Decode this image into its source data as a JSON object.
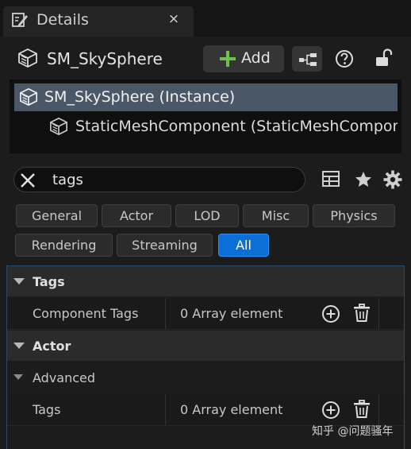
{
  "tab": {
    "title": "Details",
    "close": "×"
  },
  "header": {
    "actor_name": "SM_SkySphere",
    "add_label": "Add"
  },
  "tree": {
    "items": [
      {
        "label": "SM_SkySphere (Instance)",
        "selected": true
      },
      {
        "label": "StaticMeshComponent (StaticMeshComponent)",
        "selected": false
      }
    ]
  },
  "search": {
    "value": "tags"
  },
  "filters": [
    {
      "label": "General",
      "active": false
    },
    {
      "label": "Actor",
      "active": false
    },
    {
      "label": "LOD",
      "active": false
    },
    {
      "label": "Misc",
      "active": false
    },
    {
      "label": "Physics",
      "active": false
    },
    {
      "label": "Rendering",
      "active": false
    },
    {
      "label": "Streaming",
      "active": false
    },
    {
      "label": "All",
      "active": true
    }
  ],
  "sections": {
    "tags": {
      "title": "Tags",
      "property": {
        "name": "Component Tags",
        "value": "0 Array element"
      }
    },
    "actor": {
      "title": "Actor",
      "advanced": "Advanced",
      "property": {
        "name": "Tags",
        "value": "0 Array element"
      }
    }
  },
  "watermark": "知乎 @问题骚年",
  "colors": {
    "accent": "#0b6fd8",
    "selection": "#4a5766",
    "add_plus": "#6cc24a"
  },
  "icons": [
    "details-pencil-icon",
    "close-icon",
    "static-mesh-cube-icon",
    "plus-icon",
    "blueprint-icon",
    "help-icon",
    "unlock-icon",
    "clear-x-icon",
    "table-view-icon",
    "star-icon",
    "gear-icon",
    "add-element-icon",
    "delete-trash-icon"
  ]
}
